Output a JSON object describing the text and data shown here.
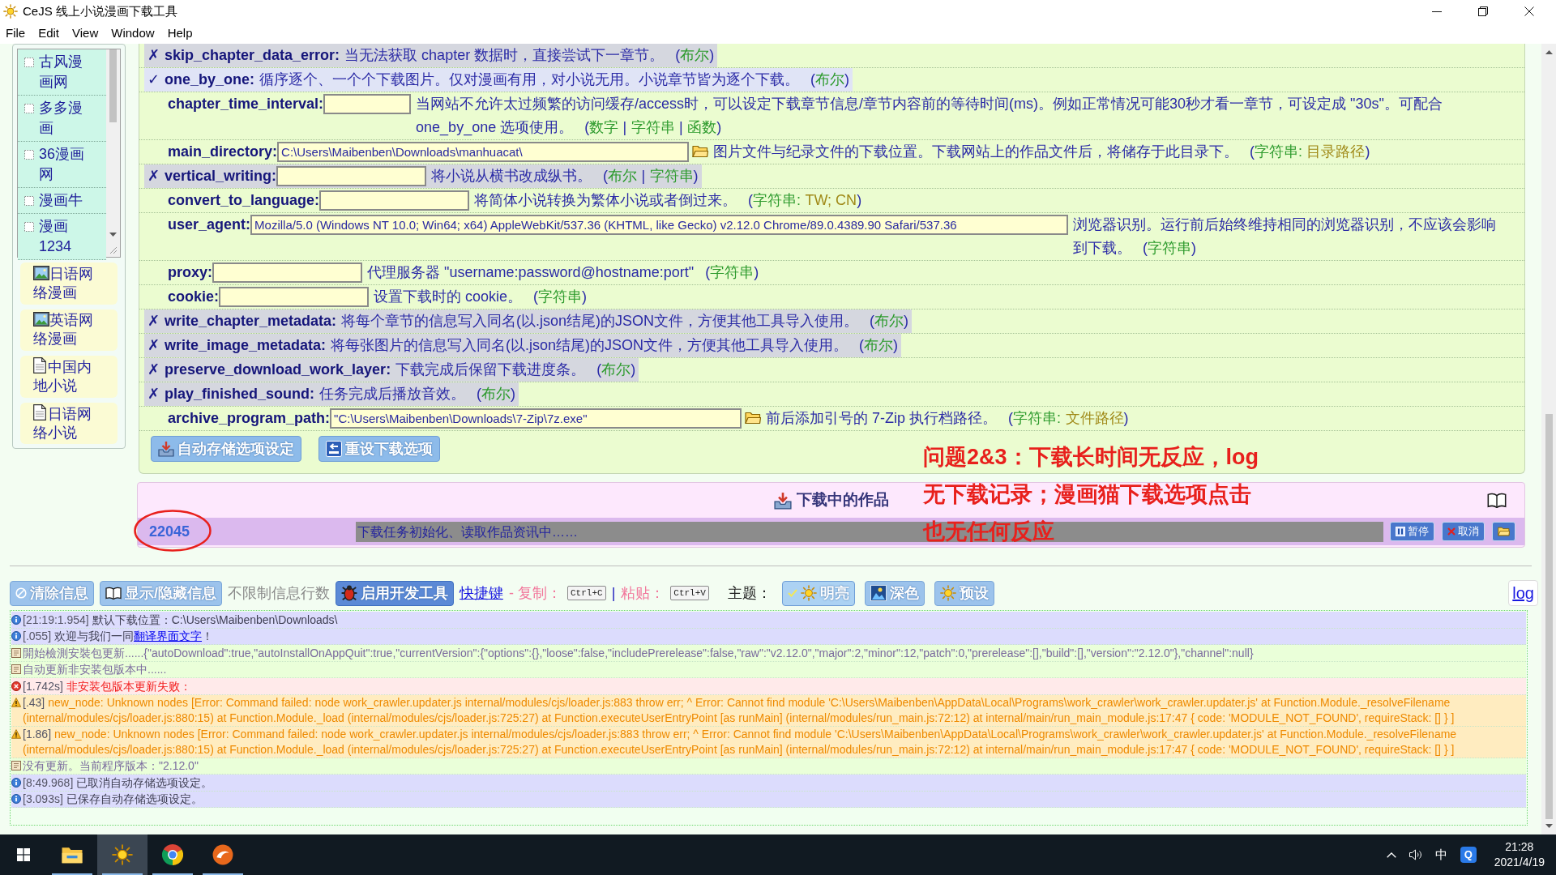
{
  "window": {
    "title": "CeJS 线上小说漫画下载工具"
  },
  "menu": [
    "File",
    "Edit",
    "View",
    "Window",
    "Help"
  ],
  "sidebar": {
    "sites": [
      {
        "label": "古风漫画网",
        "checked": false
      },
      {
        "label": "多多漫画",
        "checked": false
      },
      {
        "label": "36漫画网",
        "checked": false
      },
      {
        "label": "漫画牛",
        "checked": false
      },
      {
        "label": "漫画1234",
        "checked": false
      }
    ],
    "categories": [
      {
        "label": "日语网络漫画",
        "kind": "comic"
      },
      {
        "label": "英语网络漫画",
        "kind": "comic"
      },
      {
        "label": "中国内地小说",
        "kind": "novel"
      },
      {
        "label": "日语网络小说",
        "kind": "novel"
      }
    ]
  },
  "options": [
    {
      "toggle": {
        "mark": "✗",
        "checked": false
      },
      "name": "skip_chapter_data_error:",
      "description": "当无法获取 chapter 数据时，直接尝试下一章节。",
      "hint": [
        {
          "text": "(",
          "kind": "punct"
        },
        {
          "text": "布尔",
          "kind": "type"
        },
        {
          "text": ")",
          "kind": "punct"
        }
      ]
    },
    {
      "toggle": {
        "mark": "✓",
        "checked": true
      },
      "name": "one_by_one:",
      "description": "循序逐个、一个个下载图片。仅对漫画有用，对小说无用。小说章节皆为逐个下载。",
      "hint": [
        {
          "text": "(",
          "kind": "punct"
        },
        {
          "text": "布尔",
          "kind": "type"
        },
        {
          "text": ")",
          "kind": "punct"
        }
      ]
    },
    {
      "name": "chapter_time_interval:",
      "field": {
        "kind": "number"
      },
      "description": "当网站不允许太过频繁的访问缓存/access时，可以设定下载章节信息/章节内容前的等待时间(ms)。例如正常情况可能30秒才看一章节，可设定成 \"30s\"。可配合 one_by_one 选项使用。",
      "hint": [
        {
          "text": "(",
          "kind": "punct"
        },
        {
          "text": "数字",
          "kind": "type"
        },
        {
          "text": "|",
          "kind": "sep"
        },
        {
          "text": "字符串",
          "kind": "type"
        },
        {
          "text": "|",
          "kind": "sep"
        },
        {
          "text": "函数",
          "kind": "type"
        },
        {
          "text": ")",
          "kind": "punct"
        }
      ]
    },
    {
      "name": "main_directory:",
      "field": {
        "kind": "path",
        "value": "C:\\Users\\Maibenben\\Downloads\\manhuacat\\"
      },
      "description": "图片文件与纪录文件的下载位置。下载网站上的作品文件后，将储存于此目录下。",
      "hint": [
        {
          "text": "(",
          "kind": "punct"
        },
        {
          "text": "字符串:",
          "kind": "type"
        },
        {
          "text": "目录路径",
          "kind": "value"
        },
        {
          "text": ")",
          "kind": "punct"
        }
      ]
    },
    {
      "toggle": {
        "mark": "✗",
        "checked": false
      },
      "name": "vertical_writing:",
      "field": {
        "kind": "text"
      },
      "description": "将小说从横书改成纵书。",
      "hint": [
        {
          "text": "(",
          "kind": "punct"
        },
        {
          "text": "布尔",
          "kind": "type"
        },
        {
          "text": "|",
          "kind": "sep"
        },
        {
          "text": "字符串",
          "kind": "type"
        },
        {
          "text": ")",
          "kind": "punct"
        }
      ]
    },
    {
      "name": "convert_to_language:",
      "field": {
        "kind": "text"
      },
      "description": "将简体小说转换为繁体小说或者倒过来。",
      "hint": [
        {
          "text": "(",
          "kind": "punct"
        },
        {
          "text": "字符串:",
          "kind": "type"
        },
        {
          "text": "TW; CN",
          "kind": "value"
        },
        {
          "text": ")",
          "kind": "punct"
        }
      ]
    },
    {
      "name": "user_agent:",
      "field": {
        "kind": "wide",
        "value": "Mozilla/5.0 (Windows NT 10.0; Win64; x64) AppleWebKit/537.36 (KHTML, like Gecko) v2.12.0 Chrome/89.0.4389.90 Safari/537.36"
      },
      "description": "浏览器识别。运行前后始终维持相同的浏览器识别，不应该会影响到下载。",
      "hint": [
        {
          "text": "(",
          "kind": "punct"
        },
        {
          "text": "字符串",
          "kind": "type"
        },
        {
          "text": ")",
          "kind": "punct"
        }
      ]
    },
    {
      "name": "proxy:",
      "field": {
        "kind": "text"
      },
      "description": "代理服务器 \"username:password@hostname:port\"",
      "hint": [
        {
          "text": "(",
          "kind": "punct"
        },
        {
          "text": "字符串",
          "kind": "type"
        },
        {
          "text": ")",
          "kind": "punct"
        }
      ]
    },
    {
      "name": "cookie:",
      "field": {
        "kind": "text"
      },
      "description": "设置下载时的 cookie。",
      "hint": [
        {
          "text": "(",
          "kind": "punct"
        },
        {
          "text": "字符串",
          "kind": "type"
        },
        {
          "text": ")",
          "kind": "punct"
        }
      ]
    },
    {
      "toggle": {
        "mark": "✗",
        "checked": false
      },
      "name": "write_chapter_metadata:",
      "description": "将每个章节的信息写入同名(以.json结尾)的JSON文件，方便其他工具导入使用。",
      "hint": [
        {
          "text": "(",
          "kind": "punct"
        },
        {
          "text": "布尔",
          "kind": "type"
        },
        {
          "text": ")",
          "kind": "punct"
        }
      ]
    },
    {
      "toggle": {
        "mark": "✗",
        "checked": false
      },
      "name": "write_image_metadata:",
      "description": "将每张图片的信息写入同名(以.json结尾)的JSON文件，方便其他工具导入使用。",
      "hint": [
        {
          "text": "(",
          "kind": "punct"
        },
        {
          "text": "布尔",
          "kind": "type"
        },
        {
          "text": ")",
          "kind": "punct"
        }
      ]
    },
    {
      "toggle": {
        "mark": "✗",
        "checked": false
      },
      "name": "preserve_download_work_layer:",
      "description": "下载完成后保留下载进度条。",
      "hint": [
        {
          "text": "(",
          "kind": "punct"
        },
        {
          "text": "布尔",
          "kind": "type"
        },
        {
          "text": ")",
          "kind": "punct"
        }
      ]
    },
    {
      "toggle": {
        "mark": "✗",
        "checked": false
      },
      "name": "play_finished_sound:",
      "description": "任务完成后播放音效。",
      "hint": [
        {
          "text": "(",
          "kind": "punct"
        },
        {
          "text": "布尔",
          "kind": "type"
        },
        {
          "text": ")",
          "kind": "punct"
        }
      ]
    },
    {
      "name": "archive_program_path:",
      "field": {
        "kind": "path",
        "value": "\"C:\\Users\\Maibenben\\Downloads\\7-Zip\\7z.exe\""
      },
      "description": "前后添加引号的 7-Zip 执行档路径。",
      "hint": [
        {
          "text": "(",
          "kind": "punct"
        },
        {
          "text": "字符串:",
          "kind": "type"
        },
        {
          "text": "文件路径",
          "kind": "value"
        },
        {
          "text": ")",
          "kind": "punct"
        }
      ]
    }
  ],
  "actions": [
    {
      "kind": "autosave",
      "label": "自动存储选项设定"
    },
    {
      "kind": "reset",
      "label": "重设下载选项"
    }
  ],
  "downloads": {
    "title": "下载中的作品",
    "items": [
      {
        "label": "22045",
        "status": "下载任务初始化、读取作品资讯中……",
        "buttons": [
          {
            "kind": "pause",
            "label": "暂停"
          },
          {
            "kind": "cancel",
            "label": "取消"
          },
          {
            "kind": "folder"
          }
        ]
      }
    ]
  },
  "annotation": {
    "lines": [
      "问题2&3：下载长时间无反应，log",
      "无下载记录；漫画猫下载选项点击",
      "也无任何反应"
    ]
  },
  "toolbar": {
    "items": [
      {
        "kind": "clear",
        "label": "清除信息",
        "highlighted": false
      },
      {
        "kind": "display",
        "label": "显示/隐藏信息",
        "highlighted": false
      },
      {
        "kind": "note",
        "label": "不限制信息行数"
      },
      {
        "kind": "devtools",
        "label": "启用开发工具",
        "highlighted": true
      },
      {
        "kind": "link",
        "label": "快捷键"
      },
      {
        "kind": "shortcut",
        "label": "- 复制：",
        "key": "Ctrl+C"
      },
      {
        "kind": "separator",
        "label": "|"
      },
      {
        "kind": "shortcut",
        "label": "粘贴：",
        "key": "Ctrl+V"
      }
    ],
    "theme": {
      "label": "主题：",
      "options": [
        {
          "kind": "light",
          "label": "明亮",
          "selected": true
        },
        {
          "kind": "dark",
          "label": "深色",
          "selected": false
        },
        {
          "kind": "default",
          "label": "预设",
          "selected": false
        }
      ]
    },
    "log_link": "log"
  },
  "log": [
    {
      "kind": "info",
      "time": "[21:19:1.954]",
      "text": "默认下载位置：C:\\Users\\Maibenben\\Downloads\\"
    },
    {
      "kind": "info",
      "time": "[.055]",
      "text": "欢迎与我们一同",
      "link": "翻译界面文字",
      "after": "！"
    },
    {
      "kind": "note",
      "text": "開始檢測安裝包更新......{\"autoDownload\":true,\"autoInstallOnAppQuit\":true,\"currentVersion\":{\"options\":{},\"loose\":false,\"includePrerelease\":false,\"raw\":\"v2.12.0\",\"major\":2,\"minor\":12,\"patch\":0,\"prerelease\":[],\"build\":[],\"version\":\"2.12.0\"},\"channel\":null}"
    },
    {
      "kind": "note",
      "text": "自动更新非安装包版本中......"
    },
    {
      "kind": "error",
      "time": "[1.742s]",
      "text": "非安装包版本更新失败："
    },
    {
      "kind": "warning",
      "time": "[.43]",
      "text": "new_node: Unknown nodes [Error: Command failed: node work_crawler.updater.js internal/modules/cjs/loader.js:883 throw err; ^ Error: Cannot find module 'C:\\Users\\Maibenben\\AppData\\Local\\Programs\\work_crawler\\work_crawler.updater.js' at Function.Module._resolveFilename (internal/modules/cjs/loader.js:880:15) at Function.Module._load (internal/modules/cjs/loader.js:725:27) at Function.executeUserEntryPoint [as runMain] (internal/modules/run_main.js:72:12) at internal/main/run_main_module.js:17:47 { code: 'MODULE_NOT_FOUND', requireStack: [] } ]"
    },
    {
      "kind": "warning",
      "time": "[1.86]",
      "text": "new_node: Unknown nodes [Error: Command failed: node work_crawler.updater.js internal/modules/cjs/loader.js:883 throw err; ^ Error: Cannot find module 'C:\\Users\\Maibenben\\AppData\\Local\\Programs\\work_crawler\\work_crawler.updater.js' at Function.Module._resolveFilename (internal/modules/cjs/loader.js:880:15) at Function.Module._load (internal/modules/cjs/loader.js:725:27) at Function.executeUserEntryPoint [as runMain] (internal/modules/run_main.js:72:12) at internal/main/run_main_module.js:17:47 { code: 'MODULE_NOT_FOUND', requireStack: [] } ]"
    },
    {
      "kind": "note",
      "text": "没有更新。当前程序版本：\"2.12.0\""
    },
    {
      "kind": "info",
      "time": "[8:49.968]",
      "text": "已取消自动存储选项设定。"
    },
    {
      "kind": "info",
      "time": "[3.093s]",
      "text": "已保存自动存储选项设定。"
    }
  ],
  "taskbar": {
    "apps": [
      {
        "kind": "start",
        "selected": false,
        "running": false
      },
      {
        "kind": "explorer",
        "selected": false,
        "running": true
      },
      {
        "kind": "app",
        "selected": true,
        "running": true
      },
      {
        "kind": "browser",
        "selected": false,
        "running": true
      },
      {
        "kind": "other",
        "selected": false,
        "running": true
      }
    ],
    "tray": {
      "ime": "中",
      "badge": "Q",
      "time": "21:28",
      "date": "2021/4/19"
    }
  }
}
